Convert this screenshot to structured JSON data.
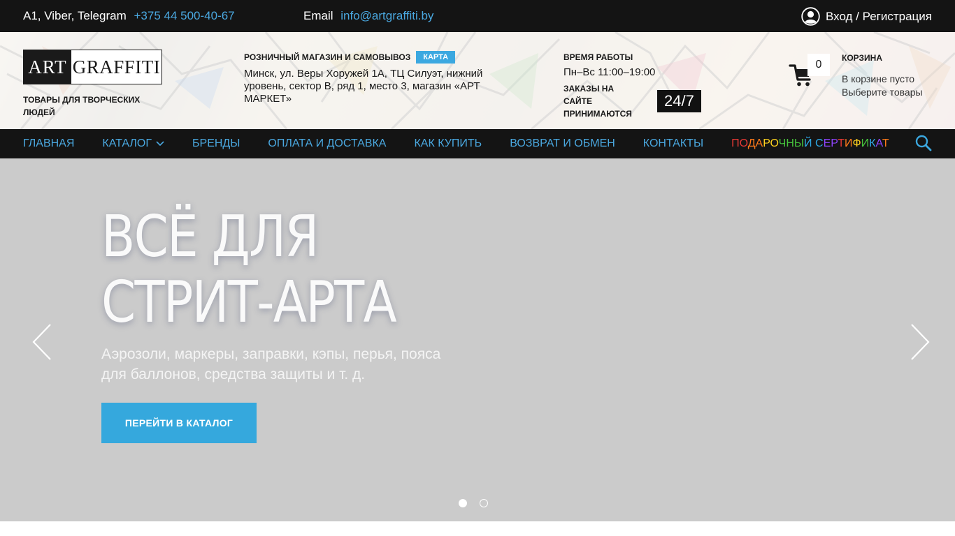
{
  "topbar": {
    "phones_label": "A1, Viber, Telegram",
    "phone": "+375 44 500-40-67",
    "email_label": "Email",
    "email": "info@artgraffiti.by",
    "auth": "Вход / Регистрация"
  },
  "header": {
    "logo": {
      "part1": "ART",
      "part2": "GRAFFITI"
    },
    "tagline": "ТОВАРЫ ДЛЯ ТВОРЧЕСКИХ ЛЮДЕЙ",
    "store": {
      "title": "РОЗНИЧНЫЙ МАГАЗИН И САМОВЫВОЗ",
      "map_button": "КАРТА",
      "address": "Минск, ул. Веры Хоружей 1А, ТЦ Силуэт, нижний уровень, сектор В, ряд 1, место 3, магазин «АРТ МАРКЕТ»"
    },
    "hours": {
      "title": "ВРЕМЯ РАБОТЫ",
      "value": "Пн–Вс 11:00–19:00",
      "orders_label": "ЗАКАЗЫ НА САЙТЕ ПРИНИМАЮТСЯ",
      "orders_badge": "24/7"
    },
    "cart": {
      "count": "0",
      "title": "КОРЗИНА",
      "line1": "В корзине пусто",
      "line2": "Выберите товары"
    }
  },
  "nav": {
    "items": [
      "ГЛАВНАЯ",
      "КАТАЛОГ",
      "БРЕНДЫ",
      "ОПЛАТА И ДОСТАВКА",
      "КАК КУПИТЬ",
      "ВОЗВРАТ И ОБМЕН",
      "КОНТАКТЫ"
    ],
    "gift": {
      "text": "ПОДАРОЧНЫЙ СЕРТИФИКАТ",
      "colors": [
        "#e53935",
        "#e53935",
        "#ff7a1a",
        "#ff7a1a",
        "#ffd21f",
        "#ffd21f",
        "#46c43c",
        "#46c43c",
        "#46c43c",
        "#2ea8e5",
        "#2ea8e5",
        "#8e44ff",
        "#8e44ff",
        "#e53935",
        "#ff7a1a",
        "#ffd21f",
        "#46c43c",
        "#2ea8e5",
        "#8e44ff",
        "#ff7a1a",
        "#ffd21f"
      ]
    }
  },
  "hero": {
    "title_line1": "ВСЁ ДЛЯ",
    "title_line2": "СТРИТ-АРТА",
    "subtitle": "Аэрозоли, маркеры, заправки, кэпы, перья, пояса для баллонов, средства защиты и т. д.",
    "cta": "ПЕРЕЙТИ В КАТАЛОГ",
    "slides_total": 2,
    "active_slide": 1
  },
  "colors": {
    "accent": "#3ba8e0",
    "dark": "#141414",
    "hero_bg": "#cbcbcb"
  },
  "icons": [
    "user-icon",
    "cart-icon",
    "chevron-down-icon",
    "search-icon",
    "arrow-left-icon",
    "arrow-right-icon"
  ]
}
